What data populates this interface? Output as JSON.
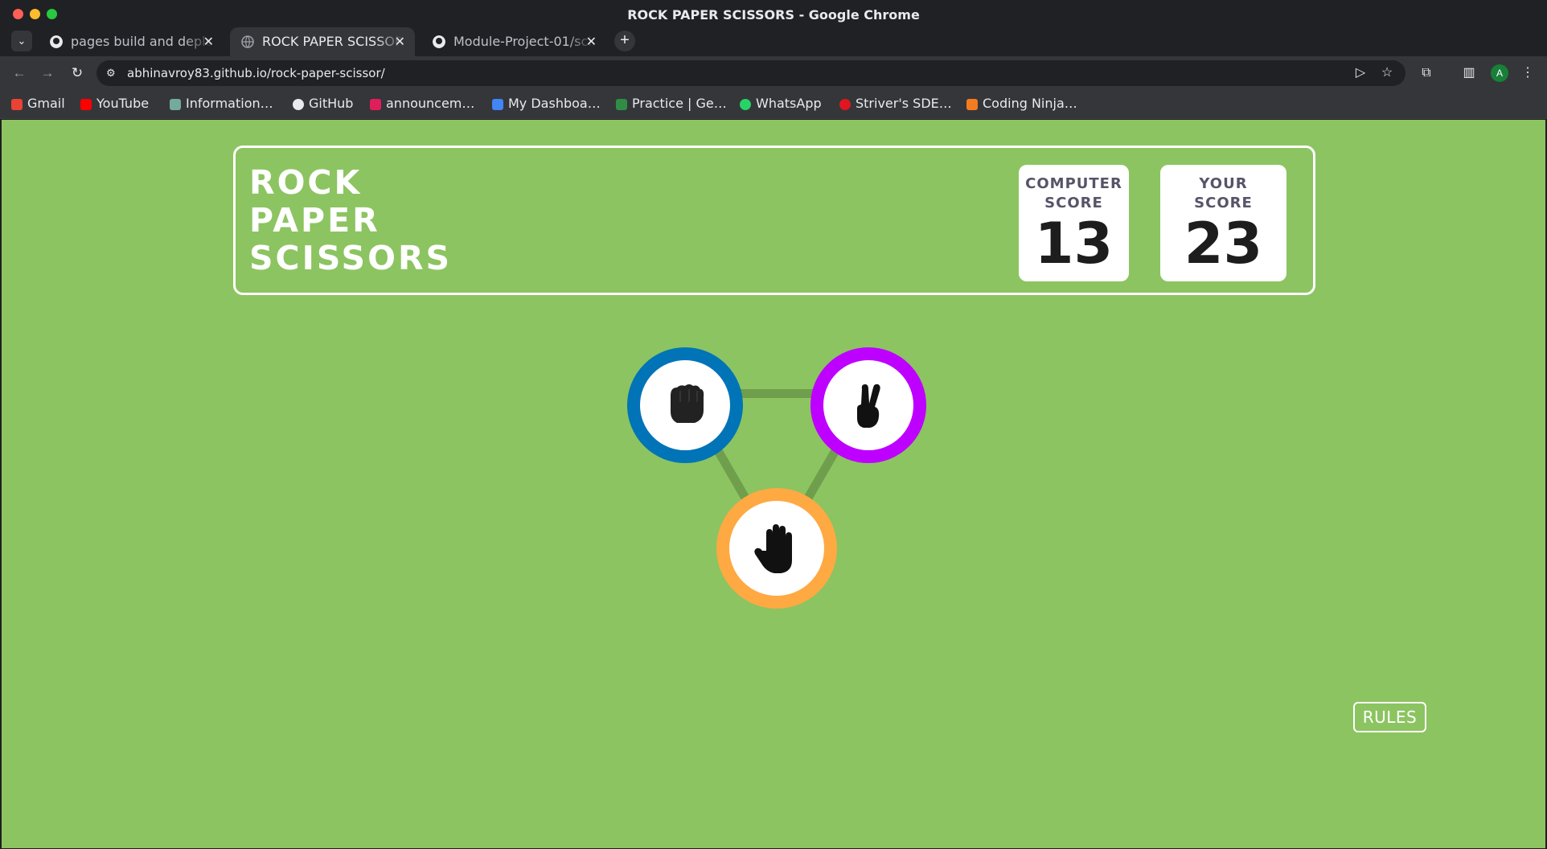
{
  "window": {
    "title": "ROCK PAPER SCISSORS - Google Chrome"
  },
  "tabs": [
    {
      "label": "pages build and deployment",
      "active": false,
      "favicon": "github-icon"
    },
    {
      "label": "ROCK PAPER SCISSORS",
      "active": true,
      "favicon": "globe-icon"
    },
    {
      "label": "Module-Project-01/scissors",
      "active": false,
      "favicon": "github-icon"
    }
  ],
  "address_bar": {
    "url": "abhinavroy83.github.io/rock-paper-scissor/"
  },
  "profile": {
    "initial": "A"
  },
  "bookmarks": [
    {
      "label": "Gmail",
      "icon": "gmail-icon",
      "color": "#ea4335"
    },
    {
      "label": "YouTube",
      "icon": "youtube-icon",
      "color": "#ff0000"
    },
    {
      "label": "Information…",
      "icon": "chatgpt-icon",
      "color": "#74aa9c"
    },
    {
      "label": "GitHub",
      "icon": "github-icon",
      "color": "#e8eaed"
    },
    {
      "label": "announcem…",
      "icon": "slack-icon",
      "color": "#e01e5a"
    },
    {
      "label": "My Dashboa…",
      "icon": "dashboard-icon",
      "color": "#4285f4"
    },
    {
      "label": "Practice | Ge…",
      "icon": "geeksforgeeks-icon",
      "color": "#2f8d46"
    },
    {
      "label": "WhatsApp",
      "icon": "whatsapp-icon",
      "color": "#25d366"
    },
    {
      "label": "Striver's SDE…",
      "icon": "takeuforward-icon",
      "color": "#e0161f"
    },
    {
      "label": "Coding Ninja…",
      "icon": "codingninjas-icon",
      "color": "#f47c20"
    }
  ],
  "game": {
    "title_lines": [
      "ROCK",
      "PAPER",
      "SCISSORS"
    ],
    "computer_score": {
      "label_line1": "COMPUTER",
      "label_line2": "SCORE",
      "value": "13"
    },
    "your_score": {
      "label_line1": "YOUR",
      "label_line2": "SCORE",
      "value": "23"
    },
    "choices": [
      {
        "name": "rock",
        "ring_color": "#0074b6",
        "icon": "fist-icon"
      },
      {
        "name": "scissors",
        "ring_color": "#bd00ff",
        "icon": "peace-hand-icon"
      },
      {
        "name": "paper",
        "ring_color": "#ffa943",
        "icon": "open-hand-icon"
      }
    ],
    "rules_button": "RULES"
  },
  "colors": {
    "background": "#8cc461",
    "connector": "#6f9e4c"
  }
}
